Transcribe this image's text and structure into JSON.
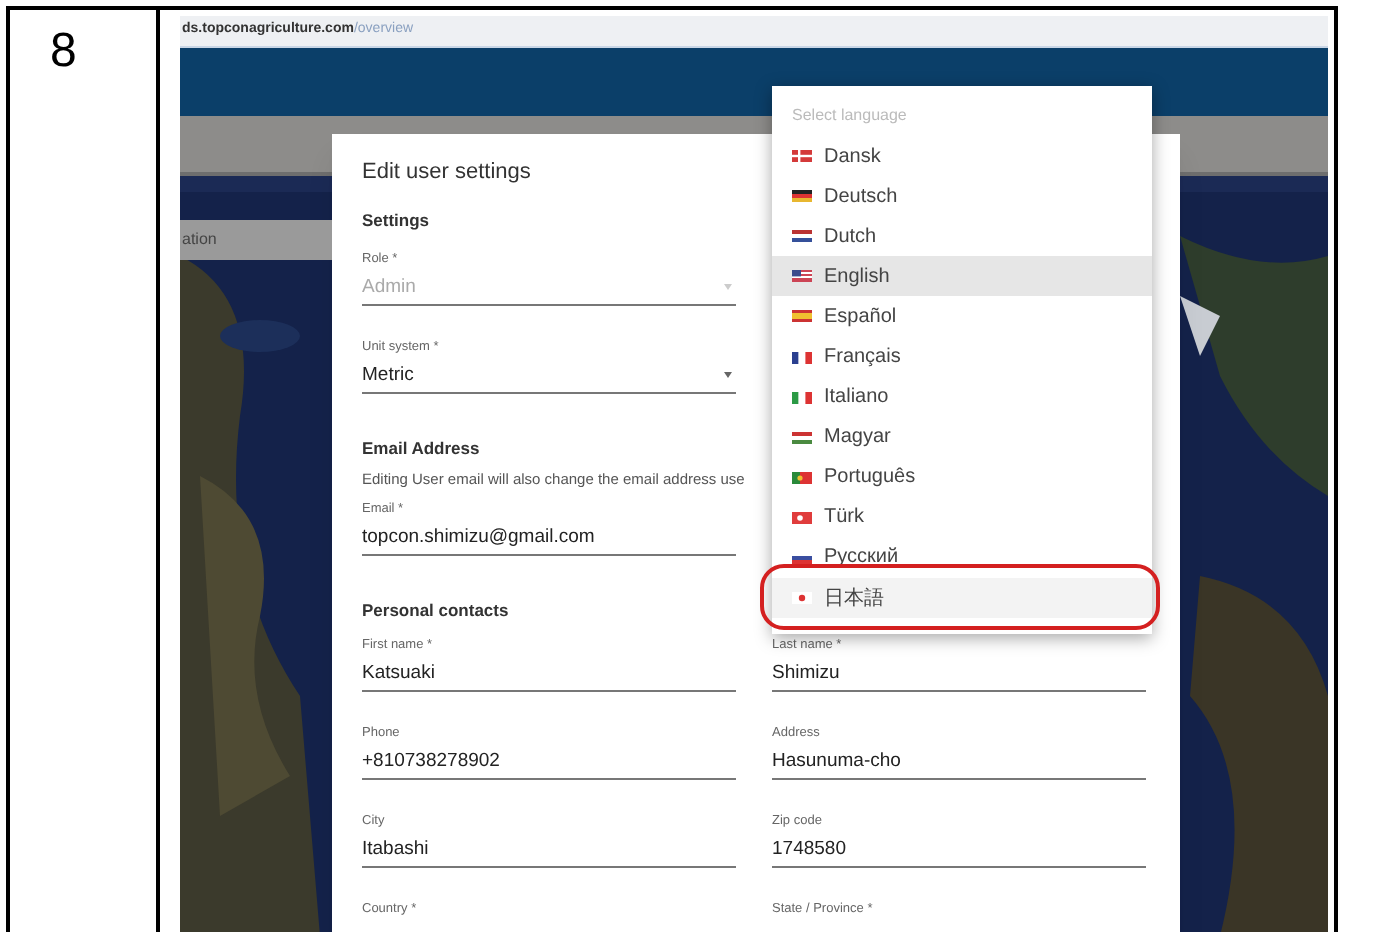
{
  "row_number": "8",
  "browser": {
    "url_host": "ds.topconagriculture.com",
    "url_path": "/overview"
  },
  "background": {
    "nav_fragment": "ation"
  },
  "dialog": {
    "title": "Edit user settings",
    "blocks": [
      {
        "kind": "heading",
        "text": "Settings"
      },
      {
        "kind": "select",
        "label": "Role *",
        "value": "Admin",
        "disabled": true
      },
      {
        "kind": "select",
        "label": "Unit system *",
        "value": "Metric",
        "disabled": false
      },
      {
        "kind": "heading",
        "text": "Email Address"
      },
      {
        "kind": "note",
        "text": "Editing User email will also change the email address use"
      },
      {
        "kind": "input",
        "label": "Email *",
        "value": "topcon.shimizu@gmail.com"
      },
      {
        "kind": "heading",
        "text": "Personal contacts"
      },
      {
        "kind": "pair",
        "fields": [
          {
            "label": "First name *",
            "value": "Katsuaki"
          },
          {
            "label": "Last name *",
            "value": "Shimizu"
          }
        ]
      },
      {
        "kind": "pair",
        "fields": [
          {
            "label": "Phone",
            "value": "+810738278902"
          },
          {
            "label": "Address",
            "value": "Hasunuma-cho"
          }
        ]
      },
      {
        "kind": "pair",
        "fields": [
          {
            "label": "City",
            "value": "Itabashi"
          },
          {
            "label": "Zip code",
            "value": "1748580"
          }
        ]
      },
      {
        "kind": "pair",
        "fields": [
          {
            "label": "Country *"
          },
          {
            "label": "State / Province *"
          }
        ]
      }
    ]
  },
  "language_menu": {
    "placeholder": "Select language",
    "items": [
      {
        "label": "Dansk",
        "kind": "dk",
        "selected": false,
        "annotated": false
      },
      {
        "label": "Deutsch",
        "kind": "de",
        "selected": false,
        "annotated": false
      },
      {
        "label": "Dutch",
        "kind": "nl",
        "selected": false,
        "annotated": false
      },
      {
        "label": "English",
        "kind": "us",
        "selected": true,
        "annotated": false
      },
      {
        "label": "Español",
        "kind": "es",
        "selected": false,
        "annotated": false
      },
      {
        "label": "Français",
        "kind": "fr",
        "selected": false,
        "annotated": false
      },
      {
        "label": "Italiano",
        "kind": "it",
        "selected": false,
        "annotated": false
      },
      {
        "label": "Magyar",
        "kind": "hu",
        "selected": false,
        "annotated": false
      },
      {
        "label": "Português",
        "kind": "pt",
        "selected": false,
        "annotated": false
      },
      {
        "label": "Türk",
        "kind": "tr",
        "selected": false,
        "annotated": false
      },
      {
        "label": "Русский",
        "kind": "ru",
        "selected": false,
        "annotated": false
      },
      {
        "label": "日本語",
        "kind": "jp",
        "selected": false,
        "annotated": true
      }
    ]
  }
}
